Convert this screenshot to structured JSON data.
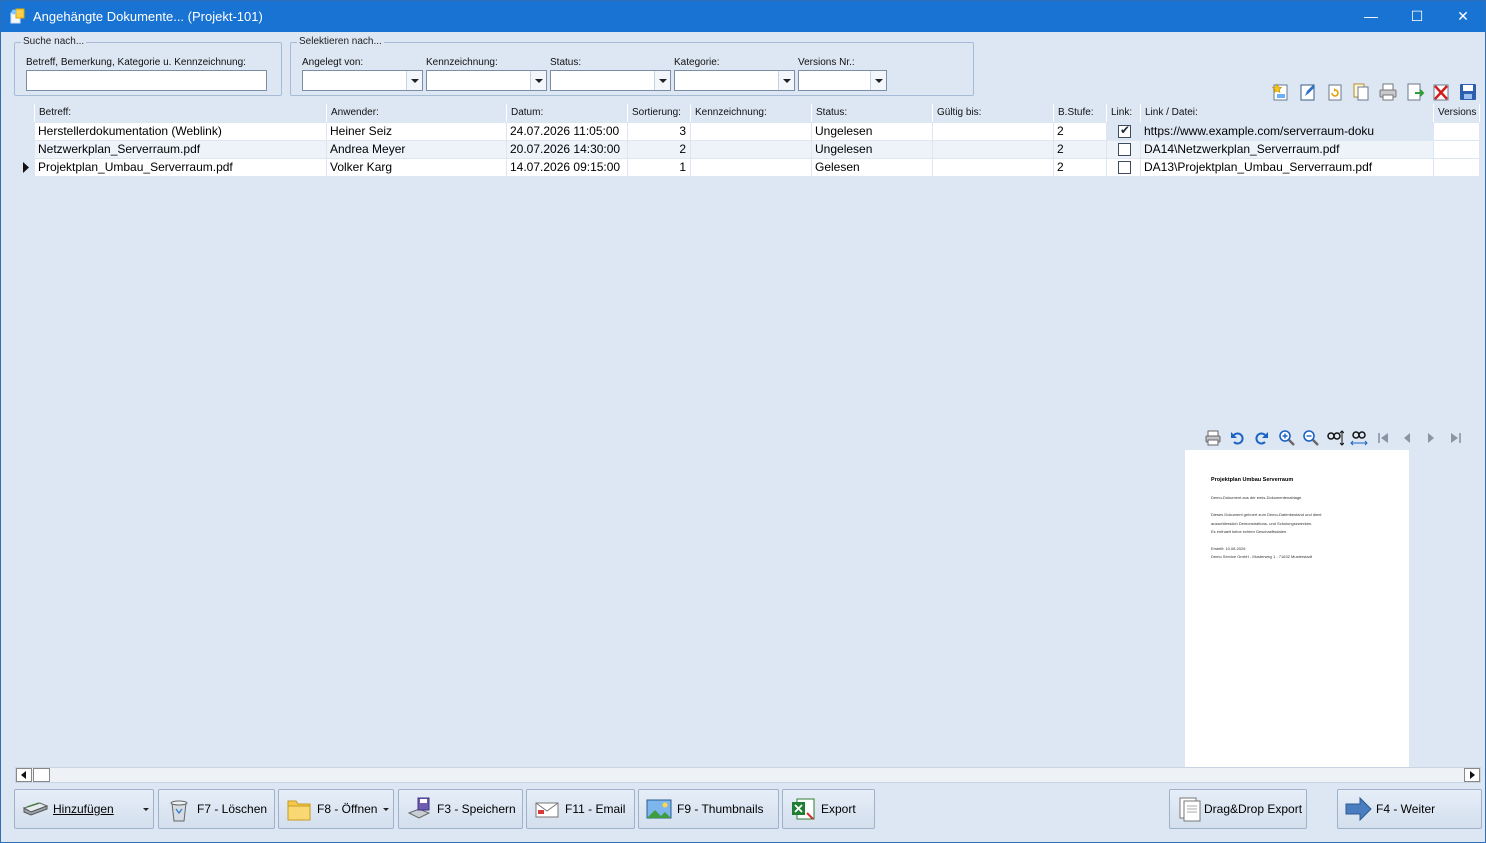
{
  "window": {
    "title": "Angehängte Dokumente... (Projekt-101)",
    "minimize": "—",
    "maximize": "☐",
    "close": "✕"
  },
  "search": {
    "group_title": "Suche nach...",
    "label": "Betreff, Bemerkung, Kategorie u. Kennzeichnung:",
    "value": ""
  },
  "filter": {
    "group_title": "Selektieren nach...",
    "fields": [
      {
        "label": "Angelegt von:",
        "value": ""
      },
      {
        "label": "Kennzeichnung:",
        "value": ""
      },
      {
        "label": "Status:",
        "value": ""
      },
      {
        "label": "Kategorie:",
        "value": ""
      },
      {
        "label": "Versions Nr.:",
        "value": ""
      }
    ]
  },
  "toolbar_icons": [
    "new-document-icon",
    "edit-icon",
    "refresh-icon",
    "copy-icon",
    "print-icon",
    "export-icon",
    "delete-icon",
    "save-icon"
  ],
  "grid": {
    "columns": [
      "Betreff:",
      "Anwender:",
      "Datum:",
      "Sortierung:",
      "Kennzeichnung:",
      "Status:",
      "Gültig bis:",
      "B.Stufe:",
      "Link:",
      "Link / Datei:",
      "Versions"
    ],
    "rows": [
      {
        "betreff": "Herstellerdokumentation (Weblink)",
        "anwender": "Heiner Seiz",
        "datum": "24.07.2026 11:05:00",
        "sortierung": "3",
        "kennzeichnung": "",
        "status": "Ungelesen",
        "gueltig": "",
        "bstufe": "2",
        "link": true,
        "datei": "https://www.example.com/serverraum-doku",
        "version": "",
        "current": false
      },
      {
        "betreff": "Netzwerkplan_Serverraum.pdf",
        "anwender": "Andrea Meyer",
        "datum": "20.07.2026 14:30:00",
        "sortierung": "2",
        "kennzeichnung": "",
        "status": "Ungelesen",
        "gueltig": "",
        "bstufe": "2",
        "link": false,
        "datei": "DA14\\Netzwerkplan_Serverraum.pdf",
        "version": "",
        "current": false
      },
      {
        "betreff": "Projektplan_Umbau_Serverraum.pdf",
        "anwender": "Volker Karg",
        "datum": "14.07.2026 09:15:00",
        "sortierung": "1",
        "kennzeichnung": "",
        "status": "Gelesen",
        "gueltig": "",
        "bstufe": "2",
        "link": false,
        "datei": "DA13\\Projektplan_Umbau_Serverraum.pdf",
        "version": "",
        "current": true
      }
    ]
  },
  "preview": {
    "toolbar_icons": [
      "print-icon",
      "rotate-left-icon",
      "rotate-right-icon",
      "zoom-in-icon",
      "zoom-out-icon",
      "fit-height-icon",
      "fit-width-icon",
      "first-page-icon",
      "previous-page-icon",
      "next-page-icon",
      "last-page-icon"
    ],
    "doc_title": "Projektplan Umbau Serverraum",
    "doc_lines": [
      "Demo-Dokument aus der emis-Dokumentenablage.",
      "Dieses Dokument gehoert zum Demo-Datenbestand und dient",
      "ausschliesslich Demonstrations- und Schulungszwecken.",
      "Es enthaelt keine echten Geschaeftsdaten.",
      "Erstellt: 10.08.2026",
      "Demo Service GmbH - Musterweg 1 - 71632 Musterstadt"
    ]
  },
  "buttons": {
    "add": "Hinzufügen",
    "delete": "F7 - Löschen",
    "open": "F8 - Öffnen",
    "save": "F3 - Speichern",
    "email": "F11 - Email",
    "thumbnails": "F9 - Thumbnails",
    "export": "Export",
    "dragdrop": "Drag&Drop Export",
    "next": "F4 - Weiter"
  }
}
